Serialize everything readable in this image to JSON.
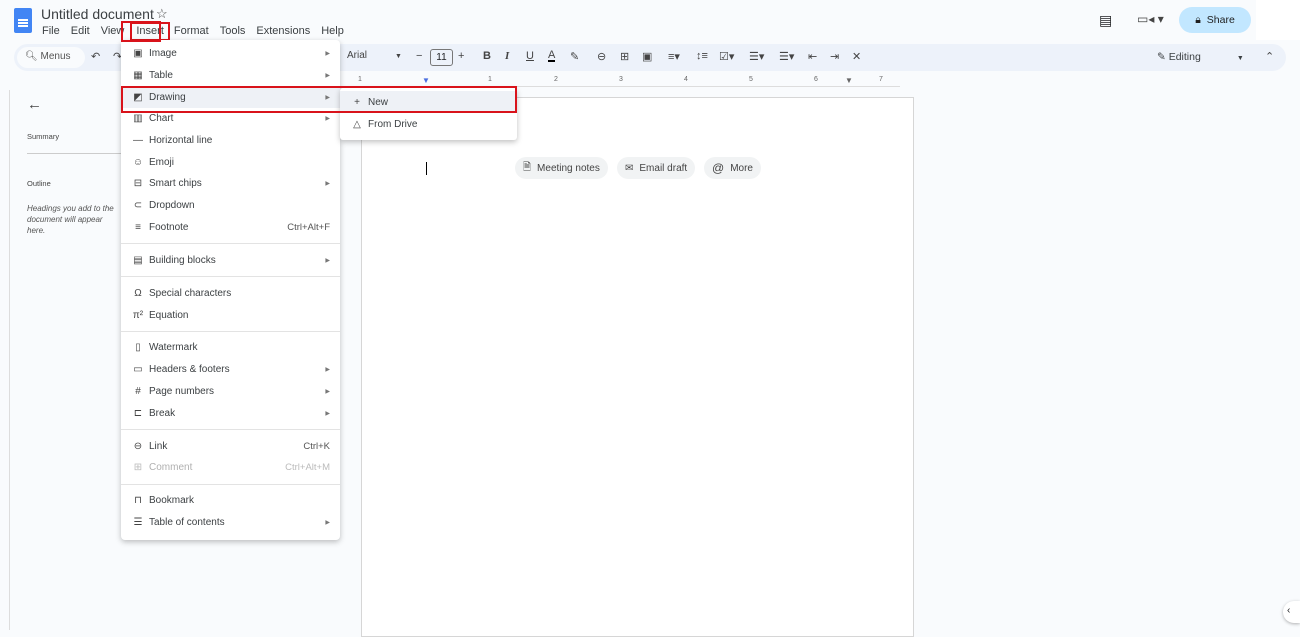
{
  "app": {
    "title": "Untitled document",
    "share_label": "Share",
    "editing_label": "Editing",
    "accent": "#4285f4",
    "highlight": "#d9131b"
  },
  "menubar": [
    "File",
    "Edit",
    "View",
    "Insert",
    "Format",
    "Tools",
    "Extensions",
    "Help"
  ],
  "toolbar": {
    "search_label": "Menus",
    "font": "Arial",
    "font_size": "11"
  },
  "ruler": [
    "1",
    "1",
    "2",
    "3",
    "4",
    "5",
    "6",
    "7"
  ],
  "outline_panel": {
    "summary": "Summary",
    "outline": "Outline",
    "hint": "Headings you add to the document will appear here."
  },
  "chips": [
    {
      "icon": "document-icon",
      "label": "Meeting notes"
    },
    {
      "icon": "email-icon",
      "label": "Email draft"
    },
    {
      "icon": "at-icon",
      "label": "More"
    }
  ],
  "insert_menu": [
    {
      "icon": "image-icon",
      "label": "Image",
      "submenu": true
    },
    {
      "icon": "table-icon",
      "label": "Table",
      "submenu": true
    },
    {
      "icon": "drawing-icon",
      "label": "Drawing",
      "submenu": true,
      "highlighted": true
    },
    {
      "icon": "chart-icon",
      "label": "Chart",
      "submenu": true
    },
    {
      "icon": "horizontal-line-icon",
      "label": "Horizontal line"
    },
    {
      "icon": "emoji-icon",
      "label": "Emoji"
    },
    {
      "icon": "smart-chips-icon",
      "label": "Smart chips",
      "submenu": true
    },
    {
      "icon": "dropdown-icon",
      "label": "Dropdown"
    },
    {
      "icon": "footnote-icon",
      "label": "Footnote",
      "shortcut": "Ctrl+Alt+F"
    },
    {
      "separator": true
    },
    {
      "icon": "building-blocks-icon",
      "label": "Building blocks",
      "submenu": true
    },
    {
      "separator": true
    },
    {
      "icon": "omega-icon",
      "label": "Special characters"
    },
    {
      "icon": "pi-icon",
      "label": "Equation"
    },
    {
      "separator": true
    },
    {
      "icon": "watermark-icon",
      "label": "Watermark"
    },
    {
      "icon": "headers-footers-icon",
      "label": "Headers & footers",
      "submenu": true
    },
    {
      "icon": "hash-icon",
      "label": "Page numbers",
      "submenu": true
    },
    {
      "icon": "break-icon",
      "label": "Break",
      "submenu": true
    },
    {
      "separator": true
    },
    {
      "icon": "link-icon",
      "label": "Link",
      "shortcut": "Ctrl+K"
    },
    {
      "icon": "comment-icon",
      "label": "Comment",
      "shortcut": "Ctrl+Alt+M",
      "disabled": true
    },
    {
      "separator": true
    },
    {
      "icon": "bookmark-icon",
      "label": "Bookmark"
    },
    {
      "icon": "toc-icon",
      "label": "Table of contents",
      "submenu": true
    }
  ],
  "drawing_submenu": [
    {
      "icon": "plus-icon",
      "label": "New",
      "highlighted": true
    },
    {
      "icon": "drive-icon",
      "label": "From Drive"
    }
  ]
}
